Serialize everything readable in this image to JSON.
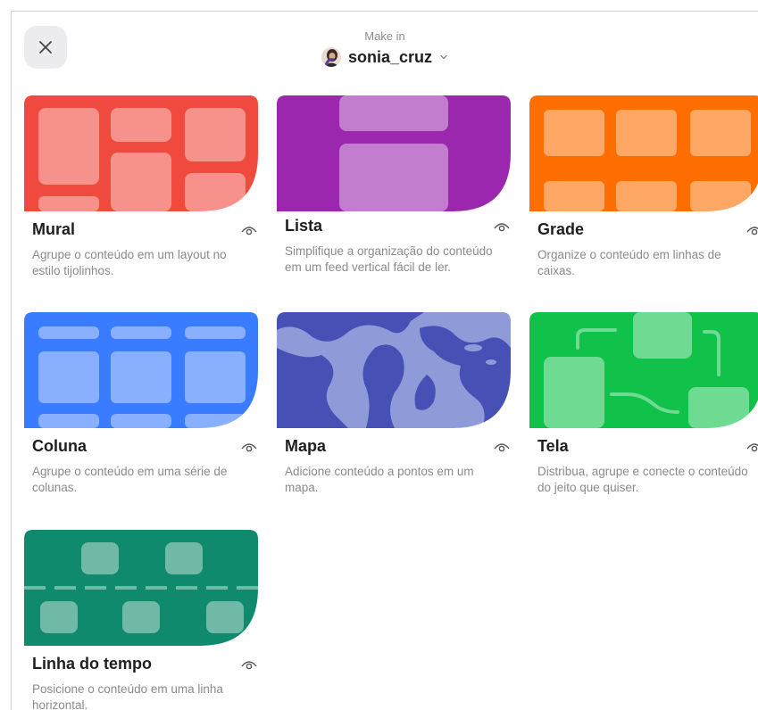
{
  "header": {
    "close_icon": "close-icon",
    "make_in_label": "Make in",
    "account_name": "sonia_cruz"
  },
  "formats": [
    {
      "title": "Mural",
      "description": "Agrupe o conteúdo em um layout no estilo tijolinhos.",
      "color": "#f04a3e"
    },
    {
      "title": "Lista",
      "description": "Simplifique a organização do conteúdo em um feed vertical fácil de ler.",
      "color": "#9b27af"
    },
    {
      "title": "Grade",
      "description": "Organize o conteúdo em linhas de caixas.",
      "color": "#ff6e00"
    },
    {
      "title": "Coluna",
      "description": "Agrupe o conteúdo em uma série de colunas.",
      "color": "#3a7cff"
    },
    {
      "title": "Mapa",
      "description": "Adicione conteúdo a pontos em um mapa.",
      "color": "#4650b5"
    },
    {
      "title": "Tela",
      "description": "Distribua, agrupe e conecte o conteúdo do jeito que quiser.",
      "color": "#10c24a"
    },
    {
      "title": "Linha do tempo",
      "description": "Posicione o conteúdo em uma linha horizontal.",
      "color": "#0f8a6c"
    }
  ]
}
